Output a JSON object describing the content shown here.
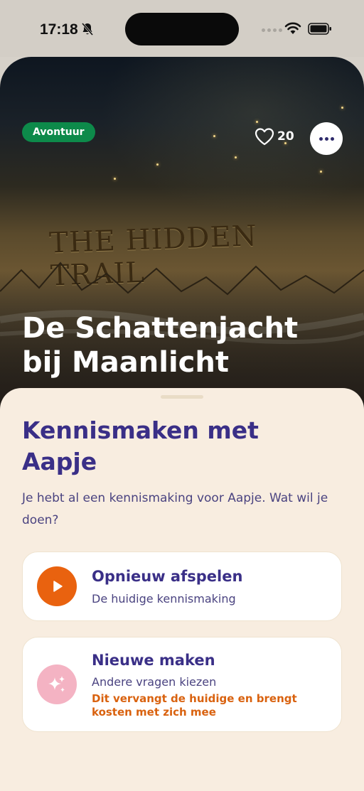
{
  "status_bar": {
    "time": "17:18"
  },
  "hero": {
    "tag": "Avontuur",
    "likes": "20",
    "map_title": "THE HIDDEN TRAIL",
    "title": "De Schattenjacht bij Maanlicht"
  },
  "sheet": {
    "title": "Kennismaken met Aapje",
    "description": "Je hebt al een kennismaking voor Aapje. Wat wil je doen?",
    "options": [
      {
        "title": "Opnieuw afspelen",
        "subtitle": "De huidige kennismaking",
        "icon": "play-icon"
      },
      {
        "title": "Nieuwe maken",
        "subtitle": "Andere vragen kiezen",
        "warning": "Dit vervangt de huidige en brengt kosten met zich mee",
        "icon": "sparkles-icon"
      }
    ]
  },
  "colors": {
    "tag_green": "#0d8a4a",
    "brand_purple": "#3a2f87",
    "orange": "#e9620f",
    "pink": "#f4b3c3",
    "sheet_bg": "#f8ede0"
  }
}
